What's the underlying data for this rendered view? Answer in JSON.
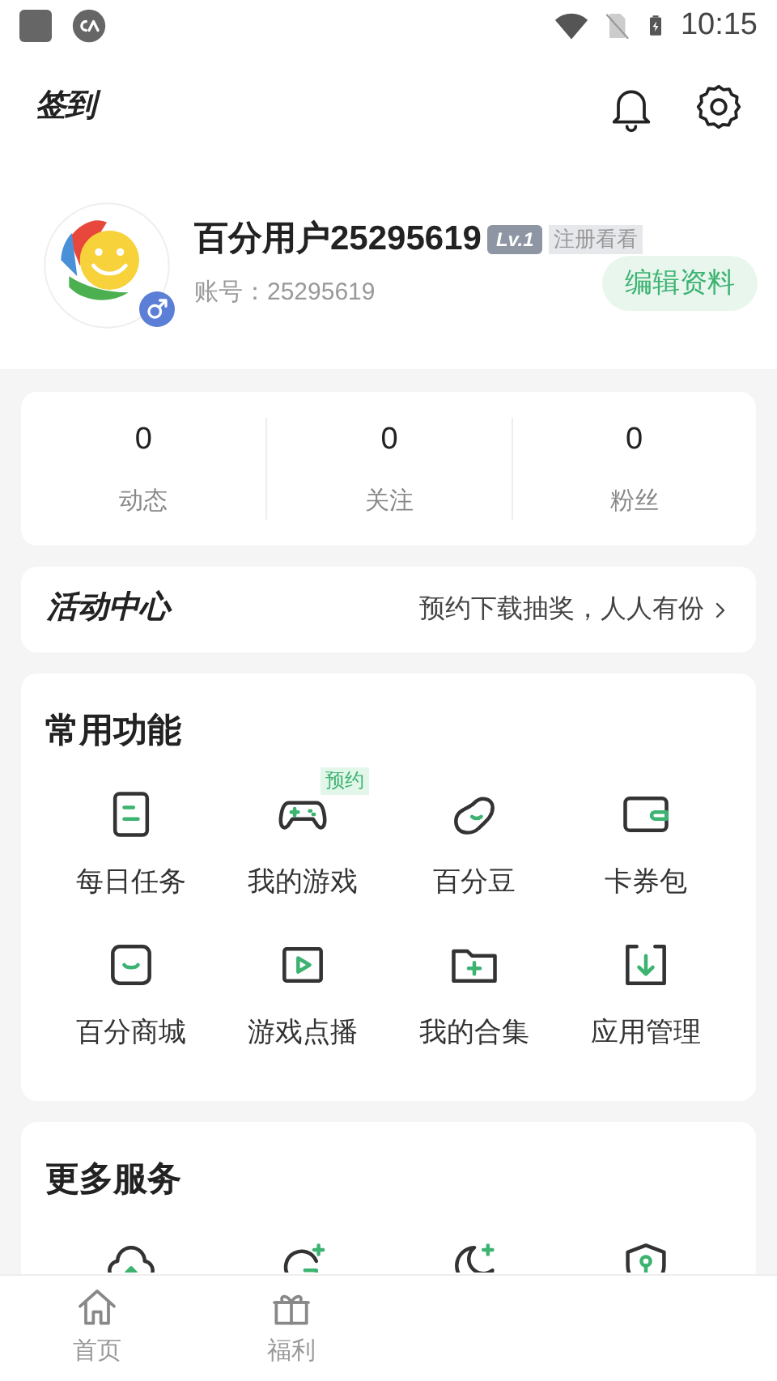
{
  "status_bar": {
    "time": "10:15"
  },
  "header": {
    "checkin": "签到"
  },
  "profile": {
    "name": "百分用户25295619",
    "level": "Lv.1",
    "register_hint": "注册看看",
    "account": "账号：25295619",
    "edit_button": "编辑资料"
  },
  "stats": [
    {
      "value": "0",
      "label": "动态"
    },
    {
      "value": "0",
      "label": "关注"
    },
    {
      "value": "0",
      "label": "粉丝"
    }
  ],
  "activity": {
    "title": "活动中心",
    "promo": "预约下载抽奖，人人有份"
  },
  "common_functions": {
    "title": "常用功能",
    "items": [
      {
        "kind": "task",
        "label": "每日任务"
      },
      {
        "kind": "gamepad",
        "label": "我的游戏",
        "badge": "预约"
      },
      {
        "kind": "bean",
        "label": "百分豆"
      },
      {
        "kind": "wallet",
        "label": "卡券包"
      },
      {
        "kind": "store",
        "label": "百分商城"
      },
      {
        "kind": "play",
        "label": "游戏点播"
      },
      {
        "kind": "folder",
        "label": "我的合集"
      },
      {
        "kind": "download",
        "label": "应用管理"
      }
    ]
  },
  "more_services": {
    "title": "更多服务",
    "items": [
      {
        "kind": "cloud"
      },
      {
        "kind": "refresh"
      },
      {
        "kind": "moon"
      },
      {
        "kind": "shield"
      }
    ]
  },
  "bottom_nav": [
    {
      "kind": "home",
      "label": "首页",
      "selected": false
    },
    {
      "kind": "gift",
      "label": "福利",
      "selected": false
    }
  ]
}
